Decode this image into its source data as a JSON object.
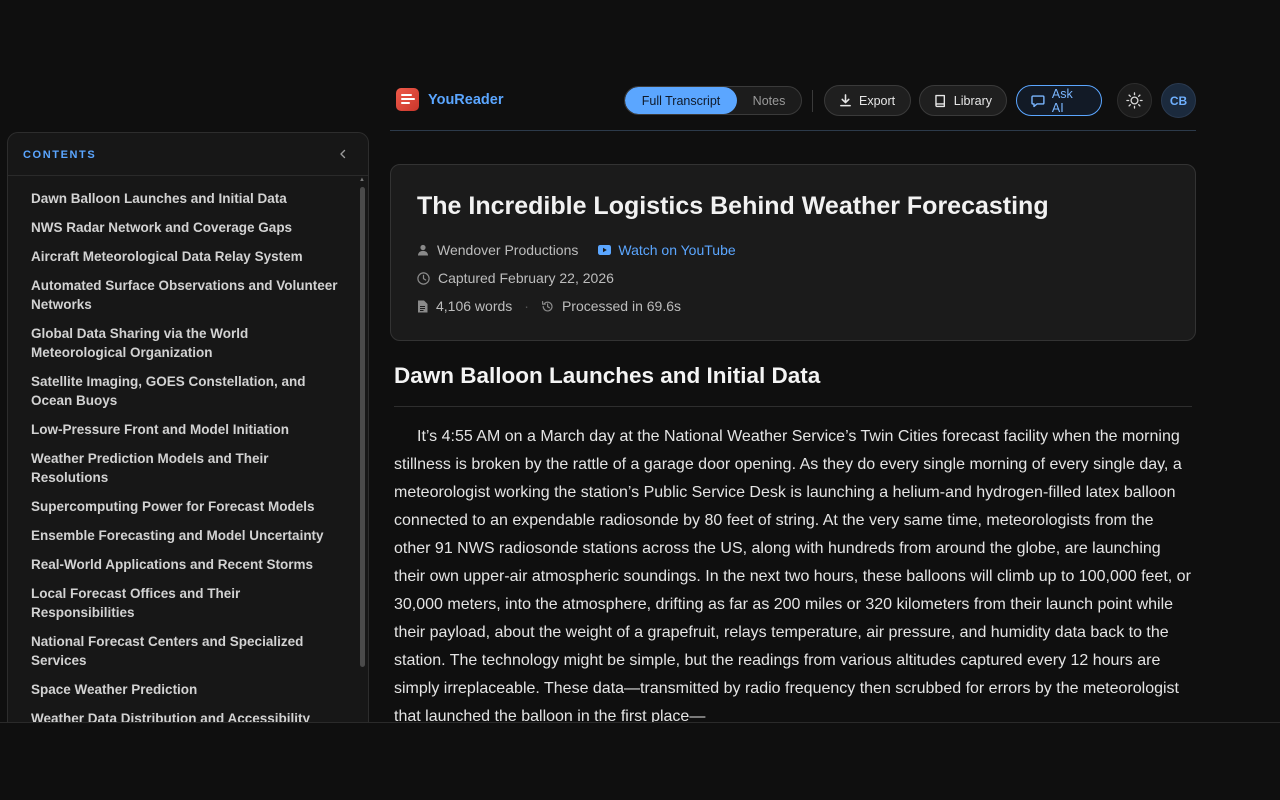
{
  "app": {
    "name": "YouReader"
  },
  "header": {
    "tabs": [
      {
        "label": "Full Transcript",
        "active": true
      },
      {
        "label": "Notes",
        "active": false
      }
    ],
    "export_label": "Export",
    "library_label": "Library",
    "ask_ai_label": "Ask AI",
    "avatar_initials": "CB"
  },
  "sidebar": {
    "title": "CONTENTS",
    "items": [
      {
        "label": "Dawn Balloon Launches and Initial Data"
      },
      {
        "label": "NWS Radar Network and Coverage Gaps"
      },
      {
        "label": "Aircraft Meteorological Data Relay System"
      },
      {
        "label": "Automated Surface Observations and Volunteer Networks"
      },
      {
        "label": "Global Data Sharing via the World Meteorological Organization"
      },
      {
        "label": "Satellite Imaging, GOES Constellation, and Ocean Buoys"
      },
      {
        "label": "Low-Pressure Front and Model Initiation"
      },
      {
        "label": "Weather Prediction Models and Their Resolutions"
      },
      {
        "label": "Supercomputing Power for Forecast Models"
      },
      {
        "label": "Ensemble Forecasting and Model Uncertainty"
      },
      {
        "label": "Real-World Applications and Recent Storms"
      },
      {
        "label": "Local Forecast Offices and Their Responsibilities"
      },
      {
        "label": "National Forecast Centers and Specialized Services"
      },
      {
        "label": "Space Weather Prediction"
      },
      {
        "label": "Weather Data Distribution and Accessibility"
      }
    ]
  },
  "document": {
    "title": "The Incredible Logistics Behind Weather Forecasting",
    "channel": "Wendover Productions",
    "watch_label": "Watch on YouTube",
    "captured": "Captured February 22, 2026",
    "words": "4,106 words",
    "processed": "Processed in 69.6s"
  },
  "article": {
    "section_title": "Dawn Balloon Launches and Initial Data",
    "paragraph": "It’s 4:55 AM on a March day at the National Weather Service’s Twin Cities forecast facility when the morning stillness is broken by the rattle of a garage door opening. As they do every single morning of every single day, a meteorologist working the station’s Public Service Desk is launching a helium-and hydrogen-filled latex balloon connected to an expendable radiosonde by 80 feet of string. At the very same time, meteorologists from the other 91 NWS radiosonde stations across the US, along with hundreds from around the globe, are launching their own upper-air atmospheric soundings. In the next two hours, these balloons will climb up to 100,000 feet, or 30,000 meters, into the atmosphere, drifting as far as 200 miles or 320 kilometers from their launch point while their payload, about the weight of a grapefruit, relays temperature, air pressure, and humidity data back to the station. The technology might be simple, but the readings from various altitudes captured every 12 hours are simply irreplaceable. These data—transmitted by radio frequency then scrubbed for errors by the meteorologist that launched the balloon in the first place—"
  }
}
